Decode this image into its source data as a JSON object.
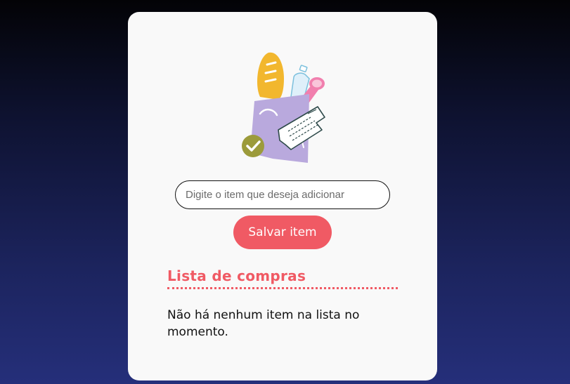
{
  "form": {
    "input_placeholder": "Digite o item que deseja adicionar",
    "input_value": "",
    "save_label": "Salvar item"
  },
  "list": {
    "title": "Lista de compras",
    "empty_message": "Não há nenhum item na lista no momento."
  },
  "illustration": {
    "icon": "grocery-bag-icon",
    "check_icon": "check-circle-icon"
  },
  "colors": {
    "accent": "#f05a64",
    "card_background": "#f9f9f9",
    "page_gradient_top": "#030306",
    "page_gradient_bottom": "#252f7a",
    "bag": "#b9a9dd",
    "bread": "#f2b72e",
    "check": "#9c9b3b",
    "sausage": "#f17fae"
  }
}
